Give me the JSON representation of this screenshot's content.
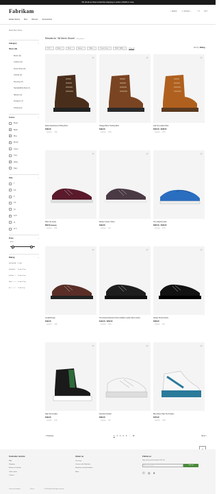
{
  "banner": "5% off all our finest sorted free shipping on orders of $100 or more",
  "brand": "Fabrikam",
  "nav": [
    "Estate Series",
    "Men",
    "Women",
    "Accessories"
  ],
  "utility": {
    "search": "Search",
    "account": "Account",
    "wishlist": "0",
    "cart": "0"
  },
  "breadcrumb": "Books Men Shoes",
  "category": {
    "title": "Category",
    "items": [
      {
        "label": "Shoes (12)",
        "sel": true,
        "sub": false
      },
      {
        "label": "Boots (11)",
        "sel": false,
        "sub": true
      },
      {
        "label": "Loafers (21)",
        "sel": false,
        "sub": true
      },
      {
        "label": "Dress Shoes (9)",
        "sel": false,
        "sub": true
      },
      {
        "label": "Oxfords (3)",
        "sel": false,
        "sub": true
      },
      {
        "label": "Running (17)",
        "sel": false,
        "sub": true
      },
      {
        "label": "Sandals&Flip-flops (3)",
        "sel": false,
        "sub": true
      },
      {
        "label": "Slippers (2)",
        "sel": false,
        "sub": true
      },
      {
        "label": "Sneakers (7)",
        "sel": false,
        "sub": true
      },
      {
        "label": "Chelsea (2)",
        "sel": false,
        "sub": true
      }
    ]
  },
  "colors": {
    "title": "Colors",
    "items": [
      {
        "label": "Beige",
        "checked": false
      },
      {
        "label": "Black",
        "checked": true
      },
      {
        "label": "Blue",
        "checked": true
      },
      {
        "label": "Brown",
        "checked": true
      },
      {
        "label": "Green",
        "checked": false
      },
      {
        "label": "Grey",
        "checked": false
      },
      {
        "label": "White",
        "checked": true
      },
      {
        "label": "Navy",
        "checked": false
      }
    ]
  },
  "size": {
    "title": "Size",
    "items": [
      {
        "label": "7",
        "checked": false
      },
      {
        "label": "8.5",
        "checked": false
      },
      {
        "label": "9",
        "checked": false
      },
      {
        "label": "9.5",
        "checked": false
      },
      {
        "label": "10",
        "checked": false
      },
      {
        "label": "10.5",
        "checked": true
      },
      {
        "label": "11",
        "checked": false
      },
      {
        "label": "11.5",
        "checked": false
      }
    ]
  },
  "price": {
    "title": "Price",
    "min_label": "$100",
    "max_label": "$1",
    "low": 0.1,
    "high": 0.85
  },
  "rating": {
    "title": "Rating",
    "items": [
      {
        "stars": "★★★★★",
        "label": "5 stars"
      },
      {
        "stars": "★★★★☆",
        "label": "4 stars & up"
      },
      {
        "stars": "★★★☆☆",
        "label": "3 stars & up"
      },
      {
        "stars": "★★☆☆☆",
        "label": "2 stars & up"
      },
      {
        "stars": "★☆☆☆☆",
        "label": "1 star & up"
      }
    ]
  },
  "results": {
    "title": "Results for \"All Men's Shoes\"",
    "count": "86 products",
    "sort_label": "Sort by:",
    "sort_value": "Rating"
  },
  "chips": [
    "10.5",
    "Black",
    "Blue",
    "Brown",
    "White",
    "4 stars & up",
    "$100 - $300"
  ],
  "clear_all": "Clear all",
  "products": [
    {
      "name": "Rebel Weatherproof Hiking Boot",
      "price": "$469.00",
      "old": "",
      "stars": "★★★★☆",
      "reviews": "(118)",
      "kind": "boot",
      "color": "#4a2e1c",
      "sole": "#222"
    },
    {
      "name": "Vintage Blaze Trekking Boot",
      "price": "$189.00",
      "old": "",
      "stars": "★★★★☆",
      "reviews": "(283)",
      "kind": "boot",
      "color": "#7a4422",
      "sole": "#2a2a2a"
    },
    {
      "name": "Cap Toe Leather Boot",
      "price": "$165.00 - $238.00",
      "old": "",
      "stars": "★★★★☆",
      "reviews": "(327)",
      "kind": "boot",
      "color": "#b0601e",
      "sole": "#5a3a20"
    },
    {
      "name": "Plain Toe Derby",
      "price": "$99.00",
      "old": "$177.00",
      "stars": "★★★★☆",
      "reviews": "(209)",
      "kind": "derby",
      "color": "#5a1a2c",
      "sole": "#ddd"
    },
    {
      "name": "Modern Suede Trainer",
      "price": "$199.00",
      "old": "",
      "stars": "★★★★☆",
      "reviews": "(99)",
      "kind": "derby",
      "color": "#4a3a44",
      "sole": "#eee"
    },
    {
      "name": "The Original Loafer",
      "price": "$395.00 - $426.00",
      "old": "",
      "stars": "★★★★☆",
      "reviews": "(217)",
      "kind": "loafer",
      "color": "#2a6ec0",
      "sole": "#fff"
    },
    {
      "name": "Gerald Brogue",
      "price": "$199.00",
      "old": "",
      "stars": "★★★★☆",
      "reviews": "(120)",
      "kind": "oxford",
      "color": "#5a2e26",
      "sole": "#222"
    },
    {
      "name": "The Double Patented Oxford Calfskin Leather Men's Derby",
      "price": "$146.00 - $256.00",
      "old": "",
      "stars": "★★★★☆",
      "reviews": "(102)",
      "kind": "oxford",
      "color": "#1e1e1e",
      "sole": "#111"
    },
    {
      "name": "Classic Shroud Derby",
      "price": "$468.00",
      "old": "",
      "stars": "★★★★☆",
      "reviews": "(98)",
      "kind": "oxford",
      "color": "#121212",
      "sole": "#000"
    },
    {
      "name": "High Top Sneaker",
      "price": "$199.00",
      "old": "",
      "stars": "★★★★☆",
      "reviews": "(219)",
      "kind": "hightop",
      "color": "#1a1a1a",
      "sole": "#fff"
    },
    {
      "name": "New Era Sneaker",
      "price": "$490.00",
      "old": "",
      "stars": "★★★★☆",
      "reviews": "(90)",
      "kind": "sneaker",
      "color": "#f5f5f5",
      "sole": "#ddd"
    },
    {
      "name": "Blue Flame High Top Sneaker",
      "price": "$470.00",
      "old": "",
      "stars": "★★★★☆",
      "reviews": "(148)",
      "kind": "sneaker2",
      "color": "#f7f7f7",
      "sole": "#2a7a9a"
    }
  ],
  "pagination": {
    "prev": "< Previous",
    "pages": [
      "1",
      "2",
      "3",
      "4",
      "5",
      "...",
      "16"
    ],
    "next": "Next >"
  },
  "footer": {
    "customer_title": "Customer service",
    "customer_links": [
      "FAQ",
      "Shipping",
      "Returns & refunds",
      "Order status",
      "Contact"
    ],
    "about_title": "About us",
    "about_links": [
      "Our story",
      "Careers with Fabrikam",
      "Fabrikam second Initiative",
      "News"
    ],
    "follow_title": "Follow us",
    "follow_text": "Sign up for email and get 10% off",
    "email_placeholder": "Enter your email",
    "signup": "Sign up",
    "bottom": [
      "Terms and conditions",
      "Privacy",
      "© 2024 Fabrikam. All rights reserved."
    ]
  }
}
